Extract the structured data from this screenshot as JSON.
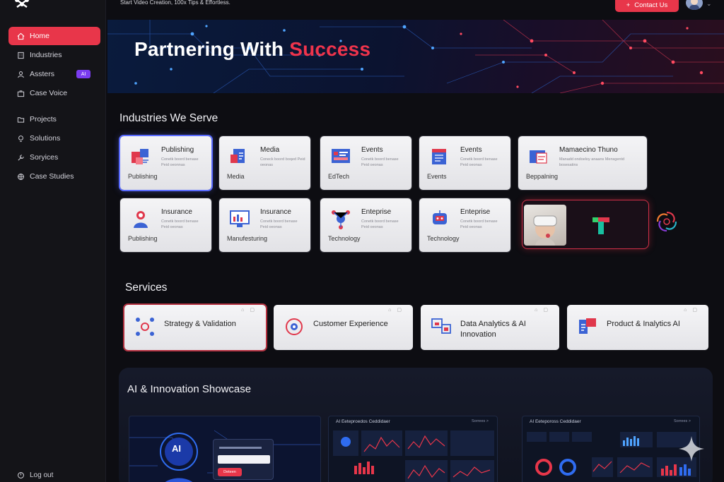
{
  "topbar": {
    "tagline": "Start Video Creation, 100x Tips & Effortless.",
    "contact_label": "Contact Us"
  },
  "sidebar": {
    "items": [
      {
        "label": "Home",
        "icon": "home-icon",
        "active": true
      },
      {
        "label": "Industries",
        "icon": "building-icon"
      },
      {
        "label": "Assters",
        "icon": "users-icon",
        "badge": "AI"
      },
      {
        "label": "Case Voice",
        "icon": "briefcase-icon"
      },
      {
        "label": "Projects",
        "icon": "folder-icon"
      },
      {
        "label": "Solutions",
        "icon": "lightbulb-icon"
      },
      {
        "label": "Soryices",
        "icon": "wrench-icon"
      },
      {
        "label": "Case Studies",
        "icon": "globe-icon"
      }
    ],
    "logout_label": "Log out"
  },
  "hero": {
    "title_prefix": "Partnering With ",
    "title_accent": "Success"
  },
  "industries": {
    "heading": "Industries We Serve",
    "cards": [
      {
        "title": "Publishing",
        "desc": "Conetk boord benase Peid oeonnas",
        "sub": "Publishing"
      },
      {
        "title": "Media",
        "desc": "Coneck boord boqed Peid oeonas",
        "sub": "Media"
      },
      {
        "title": "Events",
        "desc": "Conetk boord benase Peid oeonas",
        "sub": "EdTech"
      },
      {
        "title": "Events",
        "desc": "Conetk boord benase Peid oeonas",
        "sub": "Events"
      },
      {
        "title": "Mamaecino Thuno",
        "desc": "Manadd ondoeloy anaans Mensgentd bosesatins",
        "sub": "Beppalning"
      },
      {
        "title": "Insurance",
        "desc": "Conetk boord benase Peid oeonas",
        "sub": "Publishing"
      },
      {
        "title": "Insurance",
        "desc": "Conetk boord benase Peid oeonas",
        "sub": "Manufesturing"
      },
      {
        "title": "Enteprise",
        "desc": "Conetk boord benase Peid oeonas",
        "sub": "Technology"
      },
      {
        "title": "Enteprise",
        "desc": "Conetk boord benase Peid oeonas",
        "sub": "Technology"
      }
    ]
  },
  "services": {
    "heading": "Services",
    "cards": [
      {
        "label": "Strategy & Validation"
      },
      {
        "label": "Customer Experience"
      },
      {
        "label": "Data Analytics & AI Innovation"
      },
      {
        "label": "Product & Inalytics AI"
      }
    ]
  },
  "showcase": {
    "heading": "AI & Innovation Showcase",
    "panel_titles": [
      "AI Eeteproedos Ceddidaer",
      "AI Eetepoross Ceddidaer"
    ],
    "panel_link": "Sorrees >",
    "ai_label": "AI",
    "button_label": "Deteen"
  },
  "colors": {
    "accent": "#e8364a",
    "badge": "#7a3cf0",
    "background": "#0d0d12"
  }
}
